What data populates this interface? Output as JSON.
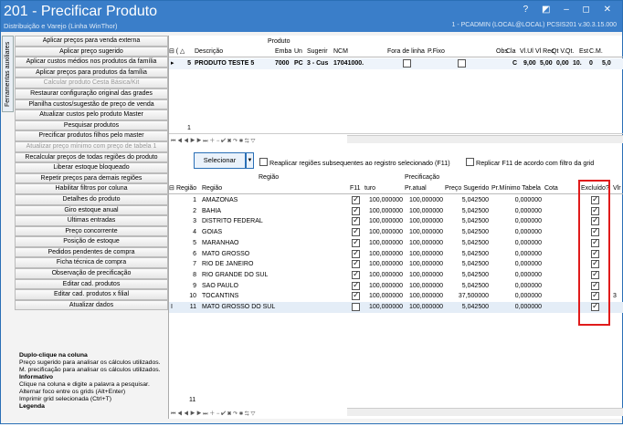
{
  "window": {
    "title": "201 - Precificar Produto",
    "subtitle": "Distribuição e Varejo (Linha WinThor)",
    "right_info": "1 - PCADMIN (LOCAL@LOCAL)   PCSIS201  v.30.3.15.000",
    "controls": "? ◩ ‒ ◻ ✕"
  },
  "sidetab": "Ferramentas auxiliares",
  "left_buttons": [
    {
      "label": "Aplicar preços para venda externa",
      "disabled": false
    },
    {
      "label": "Aplicar preço sugerido",
      "disabled": false
    },
    {
      "label": "Aplicar custos médios nos produtos da família",
      "disabled": false
    },
    {
      "label": "Aplicar preços para produtos da família",
      "disabled": false
    },
    {
      "label": "Calcular produto Cesta Básica/Kit",
      "disabled": true
    },
    {
      "label": "Restaurar configuração original das grades",
      "disabled": false
    },
    {
      "label": "Planilha custos/sugestão de preço de venda",
      "disabled": false
    },
    {
      "label": "Atualizar custos pelo produto Master",
      "disabled": false
    },
    {
      "label": "Pesquisar produtos",
      "disabled": false
    },
    {
      "label": "Precificar produtos filhos pelo master",
      "disabled": false
    },
    {
      "label": "Atualizar preço mínimo com preço de tabela 1",
      "disabled": true
    },
    {
      "label": "Recalcular preços de todas regiões do produto",
      "disabled": false
    },
    {
      "label": "Liberar estoque bloqueado",
      "disabled": false
    },
    {
      "label": "Repetir preços para demais regiões",
      "disabled": false
    },
    {
      "label": "Habilitar filtros por coluna",
      "disabled": false
    },
    {
      "label": "Detalhes do produto",
      "disabled": false
    },
    {
      "label": "Giro estoque anual",
      "disabled": false
    },
    {
      "label": "Últimas entradas",
      "disabled": false
    },
    {
      "label": "Preço concorrente",
      "disabled": false
    },
    {
      "label": "Posição de estoque",
      "disabled": false
    },
    {
      "label": "Pedidos pendentes de compra",
      "disabled": false
    },
    {
      "label": "Ficha técnica de compra",
      "disabled": false
    },
    {
      "label": "Observação de precificação",
      "disabled": false
    },
    {
      "label": "Editar cad. produtos",
      "disabled": false
    },
    {
      "label": "Editar cad. produtos x filial",
      "disabled": false
    },
    {
      "label": "Atualizar dados",
      "disabled": false
    }
  ],
  "help": {
    "h1": "Duplo-clique na coluna",
    "l1": "Preço sugerido para analisar os cálculos utilizados.",
    "l2": "M. precificação para analisar os cálculos utilizados.",
    "h2": "Informativo",
    "l3": "Clique na coluna e digite a palavra a pesquisar.",
    "l4": "Alternar foco entre os grids (Alt+Enter)",
    "l5": "Imprimir grid selecionada (Ctrl+T)",
    "h3": "Legenda"
  },
  "product_grid": {
    "group_label": "Produto",
    "headers": [
      "⊟ (",
      "△",
      "Descrição",
      "Emba",
      "Un",
      "Sugerir",
      "NCM",
      "Fora de linha",
      "P.Fixo",
      "Obs",
      "Cla",
      "Vl.Ul",
      "Vl Rec",
      "Qt V.",
      "Qt.",
      "Est",
      "C.M."
    ],
    "row": {
      "num": "5",
      "desc": "PRODUTO TESTE 5",
      "emba": "7000",
      "un": "PC",
      "sugerir": "3 - Cus",
      "ncm": "17041000.",
      "cla": "C",
      "vlul": "9,00",
      "vlrec": "5,00",
      "qtv": "0,00",
      "qt": "10.",
      "est": "0",
      "cm": "5,0"
    },
    "count": "1"
  },
  "toolbar": {
    "select_label": "Selecionar",
    "dropdown": "▼",
    "replicar": "Reaplicar regiões subsequentes ao registro selecionado (F11)",
    "replicar_f11": "Replicar F11 de acordo com filtro da grid"
  },
  "region_grid": {
    "group_regiao": "Região",
    "group_prec": "Precificação",
    "headers": {
      "regiao_num": "Região",
      "regiao_name": "Região",
      "f11": "F11",
      "turo": "turo",
      "pratual": "Pr.atual",
      "sugerido": "Preço Sugerido",
      "minimo": "Pr.Mínimo Tabela",
      "cota": "Cota",
      "excluido": "Excluído?",
      "vlr": "Vlr"
    },
    "rows": [
      {
        "n": "1",
        "name": "AMAZONAS",
        "f11": true,
        "turo": "100,000000",
        "atual": "100,000000",
        "sug": "5,042500",
        "min": "0,000000",
        "exc": true,
        "v": ""
      },
      {
        "n": "2",
        "name": "BAHIA",
        "f11": true,
        "turo": "100,000000",
        "atual": "100,000000",
        "sug": "5,042500",
        "min": "0,000000",
        "exc": true,
        "v": ""
      },
      {
        "n": "3",
        "name": "DISTRITO FEDERAL",
        "f11": true,
        "turo": "100,000000",
        "atual": "100,000000",
        "sug": "5,042500",
        "min": "0,000000",
        "exc": true,
        "v": ""
      },
      {
        "n": "4",
        "name": "GOIAS",
        "f11": true,
        "turo": "100,000000",
        "atual": "100,000000",
        "sug": "5,042500",
        "min": "0,000000",
        "exc": true,
        "v": ""
      },
      {
        "n": "5",
        "name": "MARANHAO",
        "f11": true,
        "turo": "100,000000",
        "atual": "100,000000",
        "sug": "5,042500",
        "min": "0,000000",
        "exc": true,
        "v": ""
      },
      {
        "n": "6",
        "name": "MATO GROSSO",
        "f11": true,
        "turo": "100,000000",
        "atual": "100,000000",
        "sug": "5,042500",
        "min": "0,000000",
        "exc": true,
        "v": ""
      },
      {
        "n": "7",
        "name": "RIO DE JANEIRO",
        "f11": true,
        "turo": "100,000000",
        "atual": "100,000000",
        "sug": "5,042500",
        "min": "0,000000",
        "exc": true,
        "v": ""
      },
      {
        "n": "8",
        "name": "RIO GRANDE DO SUL",
        "f11": true,
        "turo": "100,000000",
        "atual": "100,000000",
        "sug": "5,042500",
        "min": "0,000000",
        "exc": true,
        "v": ""
      },
      {
        "n": "9",
        "name": "SAO PAULO",
        "f11": true,
        "turo": "100,000000",
        "atual": "100,000000",
        "sug": "5,042500",
        "min": "0,000000",
        "exc": true,
        "v": ""
      },
      {
        "n": "10",
        "name": "TOCANTINS",
        "f11": true,
        "turo": "100,000000",
        "atual": "100,000000",
        "sug": "37,500000",
        "min": "0,000000",
        "exc": true,
        "v": "3"
      },
      {
        "n": "11",
        "name": "MATO GROSSO DO SUL",
        "f11": false,
        "turo": "100,000000",
        "atual": "100,000000",
        "sug": "5,042500",
        "min": "0,000000",
        "exc": true,
        "v": ""
      }
    ],
    "count": "11"
  },
  "nav_symbols": "⏮ ◀ ◀ ▶ ▶ ⏭ ＋ − ✔ ✖ ↷ ✱ ⇆ ▽"
}
